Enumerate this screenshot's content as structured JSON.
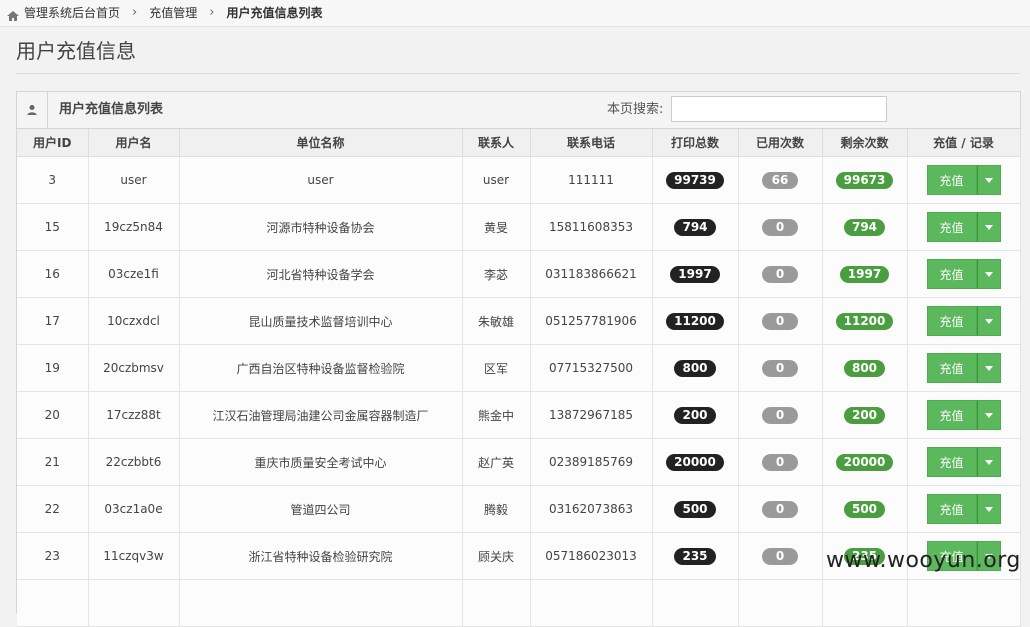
{
  "breadcrumb": {
    "home": "管理系统后台首页",
    "section": "充值管理",
    "current": "用户充值信息列表"
  },
  "page_title": "用户充值信息",
  "panel": {
    "title": "用户充值信息列表",
    "search_label": "本页搜索:",
    "search_value": ""
  },
  "table": {
    "headers": {
      "id": "用户ID",
      "username": "用户名",
      "org": "单位名称",
      "contact": "联系人",
      "phone": "联系电话",
      "total": "打印总数",
      "used": "已用次数",
      "remaining": "剩余次数",
      "action": "充值 / 记录"
    },
    "charge_label": "充值",
    "rows": [
      {
        "id": "3",
        "username": "user",
        "org": "user",
        "contact": "user",
        "phone": "111111",
        "total": "99739",
        "used": "66",
        "remaining": "99673"
      },
      {
        "id": "15",
        "username": "19cz5n84",
        "org": "河源市特种设备协会",
        "contact": "黄旻",
        "phone": "15811608353",
        "total": "794",
        "used": "0",
        "remaining": "794"
      },
      {
        "id": "16",
        "username": "03cze1fi",
        "org": "河北省特种设备学会",
        "contact": "李苾",
        "phone": "031183866621",
        "total": "1997",
        "used": "0",
        "remaining": "1997"
      },
      {
        "id": "17",
        "username": "10czxdcl",
        "org": "昆山质量技术监督培训中心",
        "contact": "朱敏雄",
        "phone": "051257781906",
        "total": "11200",
        "used": "0",
        "remaining": "11200"
      },
      {
        "id": "19",
        "username": "20czbmsv",
        "org": "广西自治区特种设备监督检验院",
        "contact": "区军",
        "phone": "07715327500",
        "total": "800",
        "used": "0",
        "remaining": "800"
      },
      {
        "id": "20",
        "username": "17czz88t",
        "org": "江汉石油管理局油建公司金属容器制造厂",
        "contact": "熊金中",
        "phone": "13872967185",
        "total": "200",
        "used": "0",
        "remaining": "200"
      },
      {
        "id": "21",
        "username": "22czbbt6",
        "org": "重庆市质量安全考试中心",
        "contact": "赵广英",
        "phone": "02389185769",
        "total": "20000",
        "used": "0",
        "remaining": "20000"
      },
      {
        "id": "22",
        "username": "03cz1a0e",
        "org": "管道四公司",
        "contact": "腾毅",
        "phone": "03162073863",
        "total": "500",
        "used": "0",
        "remaining": "500"
      },
      {
        "id": "23",
        "username": "11czqv3w",
        "org": "浙江省特种设备检验研究院",
        "contact": "顾关庆",
        "phone": "057186023013",
        "total": "235",
        "used": "0",
        "remaining": "235"
      },
      {
        "id": "",
        "username": "",
        "org": "",
        "contact": "",
        "phone": "",
        "total": "",
        "used": "",
        "remaining": ""
      }
    ]
  },
  "watermark": "www.wooyun.org",
  "colors": {
    "charge_button": "#5cb85c",
    "badge_total": "#222222",
    "badge_used": "#9a9a9a",
    "badge_remaining": "#4a9e3f"
  }
}
